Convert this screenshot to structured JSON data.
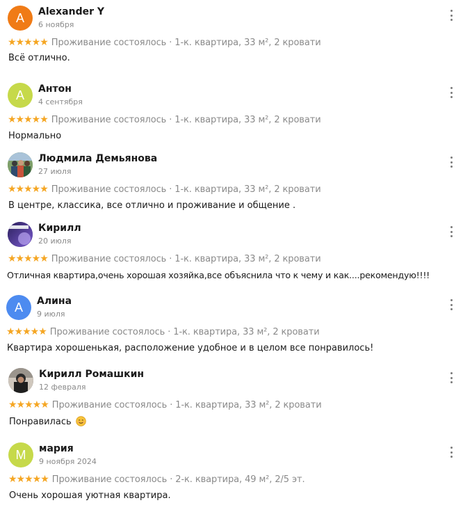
{
  "colors": {
    "star": "#f5a623",
    "muted": "#8a8a8a",
    "avatar_alexander": "#f07b16",
    "avatar_anton": "#c6d94a",
    "avatar_alina": "#4d8bf0",
    "avatar_maria": "#c6d94a"
  },
  "reviews": [
    {
      "initial": "A",
      "avatar_type": "letter",
      "name": "Alexander Y",
      "date": "6 ноября",
      "stars": "★★★★★",
      "info": "Проживание состоялось · 1-к. квартира, 33 м², 2 кровати",
      "text": "Всё отлично."
    },
    {
      "initial": "А",
      "avatar_type": "letter",
      "name": "Антон",
      "date": "4 сентября",
      "stars": "★★★★★",
      "info": "Проживание состоялось · 1-к. квартира, 33 м², 2 кровати",
      "text": "Нормально"
    },
    {
      "initial": "",
      "avatar_type": "photo",
      "name": "Людмила Демьянова",
      "date": "27 июля",
      "stars": "★★★★★",
      "info": "Проживание состоялось · 1-к. квартира, 33 м², 2 кровати",
      "text": "В центре, классика, все отлично и проживание и общение ."
    },
    {
      "initial": "",
      "avatar_type": "photo",
      "name": "Кирилл",
      "date": "20 июля",
      "stars": "★★★★★",
      "info": "Проживание состоялось · 1-к. квартира, 33 м², 2 кровати",
      "text": "Отличная квартира,очень хорошая хозяйка,все объяснила что к чему и как....рекомендую!!!!"
    },
    {
      "initial": "А",
      "avatar_type": "letter",
      "name": "Алина",
      "date": "9 июля",
      "stars": "★★★★★",
      "info": "Проживание состоялось · 1-к. квартира, 33 м², 2 кровати",
      "text": "Квартира хорошенькая, расположение удобное и в целом все понравилось!"
    },
    {
      "initial": "",
      "avatar_type": "photo",
      "name": "Кирилл Ромашкин",
      "date": "12 февраля",
      "stars": "★★★★★",
      "info": "Проживание состоялось · 1-к. квартира, 33 м², 2 кровати",
      "text": "Понравилась",
      "emoji": "smiling-face-emoji"
    },
    {
      "initial": "М",
      "avatar_type": "letter",
      "name": "мария",
      "date": "9 ноября 2024",
      "stars": "★★★★★",
      "info": "Проживание состоялось · 2-к. квартира, 49 м², 2/5 эт.",
      "text": "Очень хорошая уютная квартира."
    }
  ]
}
